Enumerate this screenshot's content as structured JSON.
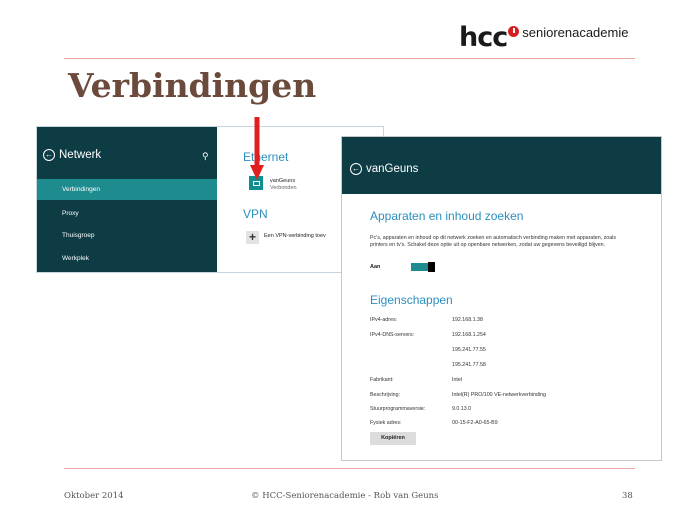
{
  "logo": {
    "brand": "hcc",
    "sub": "seniorenacademie"
  },
  "slide": {
    "title": "Verbindingen"
  },
  "network_panel": {
    "header": "Netwerk",
    "items": [
      {
        "label": "Verbindingen"
      },
      {
        "label": "Proxy"
      },
      {
        "label": "Thuisgroep"
      },
      {
        "label": "Werkplek"
      }
    ],
    "ethernet_heading": "Ethernet",
    "ethernet_name": "vanGeuns",
    "ethernet_status": "Verbonden",
    "vpn_heading": "VPN",
    "vpn_add": "Een VPN-verbinding toev"
  },
  "details_panel": {
    "header": "vanGeuns",
    "section1": "Apparaten en inhoud zoeken",
    "description": "Pc's, apparaten en inhoud op dit netwerk zoeken en automatisch verbinding maken met apparaten, zoals printers en tv's. Schakel deze optie uit op openbare netwerken, zodat uw gegevens beveiligd blijven.",
    "toggle_label": "Aan",
    "toggle_on": true,
    "section2": "Eigenschappen",
    "props": [
      {
        "label": "IPv4-adres:",
        "value": "192.168.1.38"
      },
      {
        "label": "IPv4-DNS-servers:",
        "value": "192.168.1.254"
      },
      {
        "label": "",
        "value": "195.241.77.55"
      },
      {
        "label": "",
        "value": "195.241.77.58"
      },
      {
        "label": "Fabrikant:",
        "value": "Intel"
      },
      {
        "label": "Beschrijving:",
        "value": "Intel(R) PRO/100 VE-netwerkverbinding"
      },
      {
        "label": "Stuurprogrammaversie:",
        "value": "9.0.13.0"
      },
      {
        "label": "Fysiek adres:",
        "value": "00-15-F2-A0-65-B9"
      }
    ],
    "copy_button": "Kopiëren"
  },
  "footer": {
    "date": "Oktober 2014",
    "credit": "© HCC-Seniorenacademie - Rob van Geuns",
    "page": "38"
  },
  "colors": {
    "accent_teal": "#1e8c8e",
    "dark_teal": "#0d3c45",
    "heading_blue": "#2b8fbf",
    "title_brown": "#6b4a3c",
    "arrow_red": "#e02020"
  }
}
